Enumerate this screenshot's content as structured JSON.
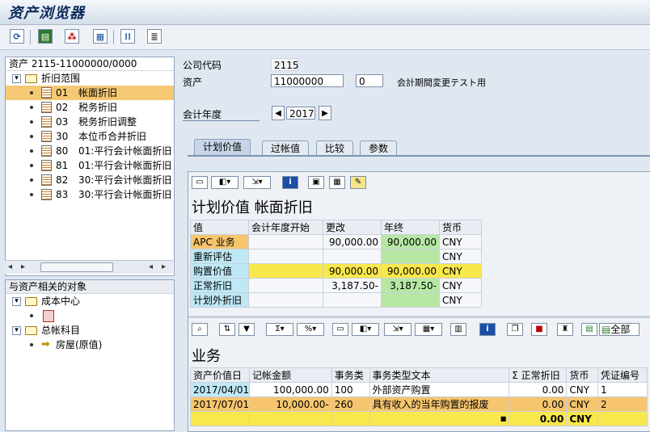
{
  "window": {
    "title": "资产浏览器"
  },
  "toolbar": {
    "icons": [
      "refresh-icon",
      "save-layout-icon",
      "print-icon",
      "structure-icon",
      "list-icon",
      "detail-icon"
    ]
  },
  "tree": {
    "header": "资产 2115-11000000/0000",
    "root_label": "折旧范围",
    "items": [
      {
        "code": "01",
        "label": "帐面折旧"
      },
      {
        "code": "02",
        "label": "税务折旧"
      },
      {
        "code": "03",
        "label": "税务折旧调整"
      },
      {
        "code": "30",
        "label": "本位币合并折旧"
      },
      {
        "code": "80",
        "label": "01:平行会计帐面折旧"
      },
      {
        "code": "81",
        "label": "01:平行会计帐面折旧"
      },
      {
        "code": "82",
        "label": "30:平行会计帐面折旧"
      },
      {
        "code": "83",
        "label": "30:平行会计帐面折旧"
      }
    ]
  },
  "related": {
    "header": "与资产相关的对象",
    "nodes": [
      {
        "label": "成本中心"
      },
      {
        "label": "总帐科目"
      },
      {
        "label": "房屋(原值)"
      }
    ]
  },
  "form": {
    "company_code_label": "公司代码",
    "company_code": "2115",
    "asset_label": "资产",
    "asset_main": "11000000",
    "asset_sub": "0",
    "asset_desc": "会計期間変更テスト用",
    "fiscal_year_label": "会计年度",
    "fiscal_year": "2017"
  },
  "tabs": [
    "计划价值",
    "过帐值",
    "比较",
    "参数"
  ],
  "planned": {
    "title": "计划价值 帐面折旧",
    "headers": [
      "值",
      "会计年度开始",
      "更改",
      "年终",
      "货币"
    ],
    "rows": [
      {
        "label": "APC 业务",
        "start": "",
        "change": "90,000.00",
        "yearend": "90,000.00",
        "currency": "CNY"
      },
      {
        "label": "重新评估",
        "start": "",
        "change": "",
        "yearend": "",
        "currency": "CNY"
      },
      {
        "label": "购置价值",
        "start": "",
        "change": "90,000.00",
        "yearend": "90,000.00",
        "currency": "CNY"
      },
      {
        "label": "正常折旧",
        "start": "",
        "change": "3,187.50-",
        "yearend": "3,187.50-",
        "currency": "CNY"
      },
      {
        "label": "计划外折旧",
        "start": "",
        "change": "",
        "yearend": "",
        "currency": "CNY"
      }
    ]
  },
  "transactions": {
    "title": "业务",
    "all_label": "全部",
    "headers": [
      "资产价值日",
      "记帐金额",
      "事务类",
      "事务类型文本",
      "Σ 正常折旧",
      "货币",
      "凭证编号"
    ],
    "rows": [
      {
        "date": "2017/04/01",
        "amount": "100,000.00",
        "type": "100",
        "text": "外部资产购置",
        "dep": "0.00",
        "currency": "CNY",
        "doc": "1"
      },
      {
        "date": "2017/07/01",
        "amount": "10,000.00-",
        "type": "260",
        "text": "具有收入的当年购置的报废",
        "dep": "0.00",
        "currency": "CNY",
        "doc": "2"
      }
    ],
    "total": {
      "bullet": "■",
      "dep": "0.00",
      "currency": "CNY"
    }
  }
}
